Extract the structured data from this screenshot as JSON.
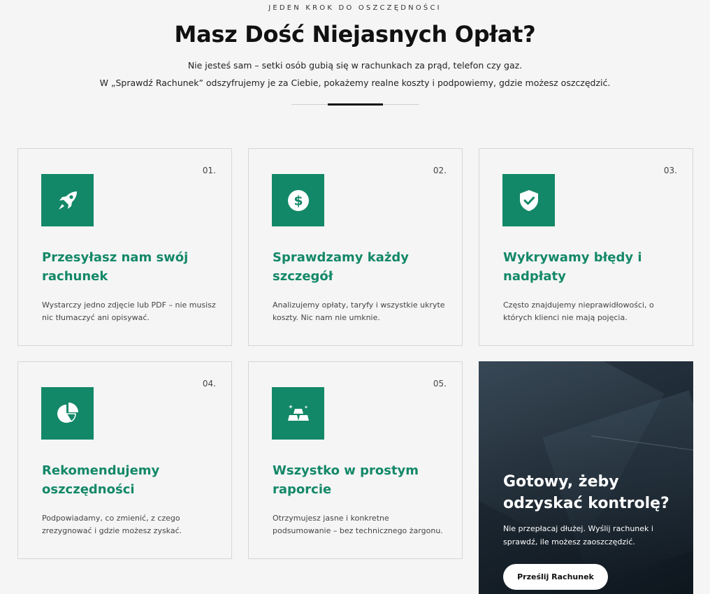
{
  "header": {
    "eyebrow": "JEDEN KROK DO OSZCZĘDNOŚCI",
    "title": "Masz Dość Niejasnych Opłat?",
    "subtitle_1": "Nie jesteś sam – setki osób gubią się w rachunkach za prąd, telefon czy gaz.",
    "subtitle_2": "W „Sprawdź Rachunek” odszyfrujemy je za Ciebie, pokażemy realne koszty i podpowiemy, gdzie możesz oszczędzić."
  },
  "colors": {
    "accent": "#138868",
    "dark": "#1c2731",
    "background": "#f5f5f5"
  },
  "steps": [
    {
      "number": "01.",
      "icon": "rocket-icon",
      "title": "Przesyłasz nam swój rachunek",
      "description": "Wystarczy jedno zdjęcie lub PDF – nie musisz nic tłumaczyć ani opisywać."
    },
    {
      "number": "02.",
      "icon": "dollar-icon",
      "title": "Sprawdzamy każdy szczegół",
      "description": "Analizujemy opłaty, taryfy i wszystkie ukryte koszty. Nic nam nie umknie."
    },
    {
      "number": "03.",
      "icon": "shield-check-icon",
      "title": "Wykrywamy błędy i nadpłaty",
      "description": "Często znajdujemy nieprawidłowości, o których klienci nie mają pojęcia."
    },
    {
      "number": "04.",
      "icon": "pie-chart-icon",
      "title": "Rekomendujemy oszczędności",
      "description": "Podpowiadamy, co zmienić, z czego zrezygnować i gdzie możesz zyskać."
    },
    {
      "number": "05.",
      "icon": "gold-bars-icon",
      "title": "Wszystko w prostym raporcie",
      "description": "Otrzymujesz jasne i konkretne podsumowanie – bez technicznego żargonu."
    }
  ],
  "cta": {
    "title": "Gotowy, żeby odzyskać kontrolę?",
    "description": "Nie przepłacaj dłużej. Wyślij rachunek i sprawdź, ile możesz zaoszczędzić.",
    "button_label": "Prześlij Rachunek"
  }
}
